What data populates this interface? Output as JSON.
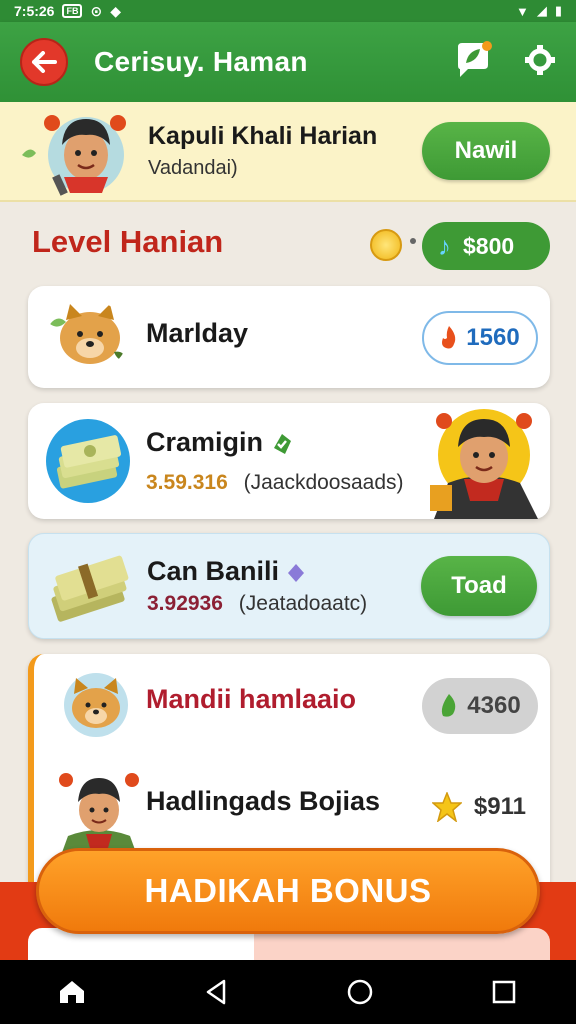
{
  "status_bar": {
    "time": "7:5:26",
    "badge": "FB"
  },
  "app_bar": {
    "title": "Cerisuy. Haman"
  },
  "profile": {
    "name": "Kapuli Khali Harian",
    "subtitle": "Vadandai)",
    "button_label": "Nawil"
  },
  "section": {
    "title": "Level Hanian",
    "balance": "$800"
  },
  "cards": [
    {
      "title": "Marlday",
      "value": "1560"
    },
    {
      "title": "Cramigin",
      "amount": "3.59.316",
      "note": "(Jaackdoosaads)"
    },
    {
      "title": "Can Banili",
      "amount": "3.92936",
      "note": "(Jeatadoaatc)",
      "button_label": "Toad"
    },
    {
      "title": "Mandii hamlaaio",
      "value": "4360",
      "title_color": "#b01d2e"
    },
    {
      "title": "Hadlingads Bojias",
      "value": "$911"
    }
  ],
  "bonus_button": {
    "label": "HADIKAH BONUS"
  },
  "colors": {
    "primary_green": "#2e8b34",
    "accent_orange": "#f07a0c",
    "alert_red": "#c0261b"
  },
  "icons": {
    "back": "arrow-left-icon",
    "chat": "chat-leaf-icon",
    "settings": "settings-icon",
    "home": "home-icon",
    "nav_back": "triangle-back-icon",
    "nav_home": "circle-home-icon",
    "nav_recent": "square-recent-icon"
  }
}
